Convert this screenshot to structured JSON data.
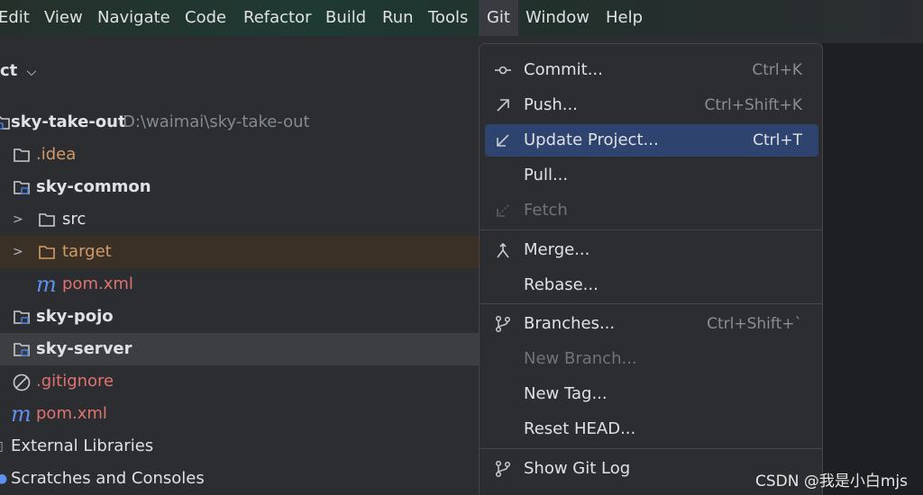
{
  "menubar": {
    "items": [
      "Edit",
      "View",
      "Navigate",
      "Code",
      "Refactor",
      "Build",
      "Run",
      "Tools",
      "Git",
      "Window",
      "Help"
    ],
    "active": "Git"
  },
  "project": {
    "label": "ct"
  },
  "tree": {
    "root_name": "sky-take-out",
    "root_path": "D:\\waimai\\sky-take-out",
    "idea": ".idea",
    "common": "sky-common",
    "src": "src",
    "target": "target",
    "pom_common": "pom.xml",
    "pojo": "sky-pojo",
    "server": "sky-server",
    "gitignore": ".gitignore",
    "pom_root": "pom.xml",
    "external": "External Libraries",
    "scratches": "Scratches and Consoles"
  },
  "git_menu": {
    "commit": {
      "label": "Commit...",
      "shortcut": "Ctrl+K"
    },
    "push": {
      "label": "Push...",
      "shortcut": "Ctrl+Shift+K"
    },
    "update": {
      "label": "Update Project...",
      "shortcut": "Ctrl+T"
    },
    "pull": {
      "label": "Pull..."
    },
    "fetch": {
      "label": "Fetch"
    },
    "merge": {
      "label": "Merge..."
    },
    "rebase": {
      "label": "Rebase..."
    },
    "branches": {
      "label": "Branches...",
      "shortcut": "Ctrl+Shift+`"
    },
    "new_branch": {
      "label": "New Branch..."
    },
    "new_tag": {
      "label": "New Tag..."
    },
    "reset_head": {
      "label": "Reset HEAD..."
    },
    "show_log": {
      "label": "Show Git Log"
    }
  },
  "watermark": "CSDN @我是小白mjs",
  "colors": {
    "accent": "#2e436e",
    "target_highlight": "#3a3025",
    "module_icon": "#4a7bd6"
  }
}
